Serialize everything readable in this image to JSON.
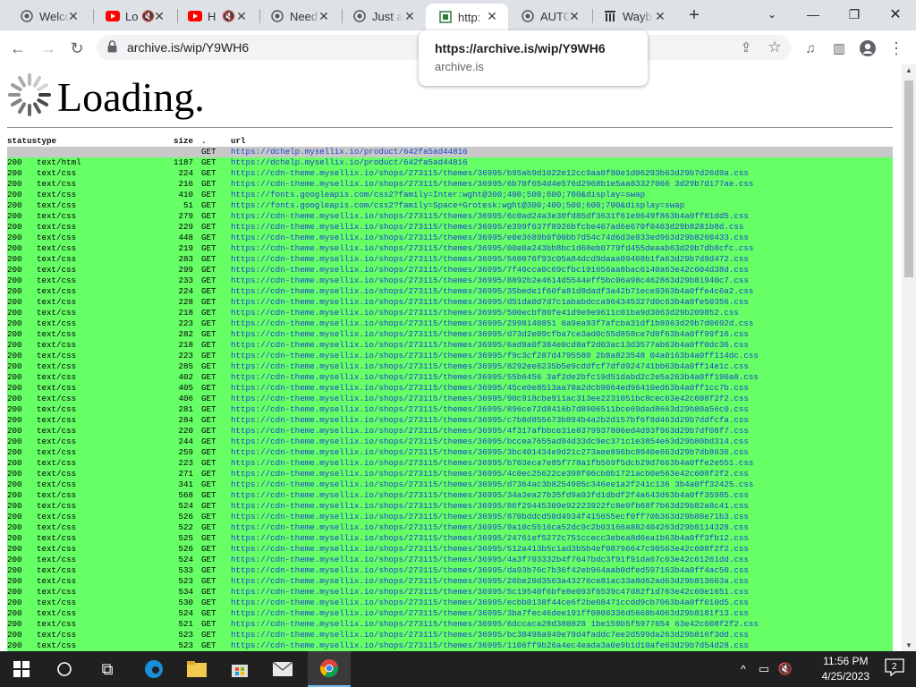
{
  "tabs": [
    {
      "title": "Welco",
      "icon": "globe-icon",
      "muted": false
    },
    {
      "title": "Lo",
      "icon": "youtube-icon",
      "muted": true
    },
    {
      "title": "H",
      "icon": "youtube-icon",
      "muted": true
    },
    {
      "title": "Need",
      "icon": "globe-icon",
      "muted": false
    },
    {
      "title": "Just a",
      "icon": "globe-icon",
      "muted": false
    },
    {
      "title": "http:",
      "icon": "archive-icon",
      "muted": false,
      "active": true
    },
    {
      "title": "AUTO",
      "icon": "globe-icon",
      "muted": false
    },
    {
      "title": "Wayb",
      "icon": "wayback-icon",
      "muted": false
    }
  ],
  "address_bar": {
    "url": "archive.is/wip/Y9WH6"
  },
  "tooltip": {
    "title": "https://archive.is/wip/Y9WH6",
    "host": "archive.is"
  },
  "page": {
    "loading_text": "Loading."
  },
  "table": {
    "headers": {
      "status": "status",
      "type": "type",
      "size": "size",
      "method": ".",
      "url": "url"
    },
    "rows": [
      {
        "status": "",
        "type": "",
        "size": "",
        "method": "GET",
        "url": "https://dchelp.mysellix.io/product/642fa5ad44816",
        "style": "gray"
      },
      {
        "status": "200",
        "type": "text/html",
        "size": "1187",
        "method": "GET",
        "url": "https://dchelp.mysellix.io/product/642fa5ad44816",
        "style": "green"
      },
      {
        "status": "200",
        "type": "text/css",
        "size": "224",
        "method": "GET",
        "url": "https://cdn-theme.mysellix.io/shops/273115/themes/36995/b95ab9d1022e12cc9aa0f80e1d06293b63d29b7d26d9a.css",
        "style": "green"
      },
      {
        "status": "200",
        "type": "text/css",
        "size": "216",
        "method": "GET",
        "url": "https://cdn-theme.mysellix.io/shops/273115/themes/36995/6b70f654d4e576d2968b1e5aa83327066 3d29b7d177ae.css",
        "style": "green"
      },
      {
        "status": "200",
        "type": "text/css",
        "size": "410",
        "method": "GET",
        "url": "https://fonts.googleapis.com/css2?family=Inter:wght@300;400;500;600;700&display=swap",
        "style": "green"
      },
      {
        "status": "200",
        "type": "text/css",
        "size": "51",
        "method": "GET",
        "url": "https://fonts.googleapis.com/css2?family=Space+Grotesk:wght@300;400;500;600;700&display=swap",
        "style": "green"
      },
      {
        "status": "200",
        "type": "text/css",
        "size": "279",
        "method": "GET",
        "url": "https://cdn-theme.mysellix.io/shops/273115/themes/36995/6c0ad24a3e30fd85df3631f61e9649f863b4a0ff81dd5.css",
        "style": "green"
      },
      {
        "status": "200",
        "type": "text/css",
        "size": "229",
        "method": "GET",
        "url": "https://cdn-theme.mysellix.io/shops/273115/themes/36995/e399f637f8926bfcbe467ad6e670f0463d29b8281b8d.css",
        "style": "green"
      },
      {
        "status": "200",
        "type": "text/css",
        "size": "448",
        "method": "GET",
        "url": "https://cdn-theme.mysellix.io/shops/273115/themes/36995/e0e3689b0f00bb7d54c74d6d3e833ed963d29b8260433.css",
        "style": "green"
      },
      {
        "status": "200",
        "type": "text/css",
        "size": "219",
        "method": "GET",
        "url": "https://cdn-theme.mysellix.io/shops/273115/themes/36995/00e0a243bb8bc1d68eb0779fd455deaab63d29b7db8cfc.css",
        "style": "green"
      },
      {
        "status": "200",
        "type": "text/css",
        "size": "283",
        "method": "GET",
        "url": "https://cdn-theme.mysellix.io/shops/273115/themes/36995/560076f93c05a84dcd9daaa09468b1fa63d29b7d9d472.css",
        "style": "green"
      },
      {
        "status": "200",
        "type": "text/css",
        "size": "299",
        "method": "GET",
        "url": "https://cdn-theme.mysellix.io/shops/273115/themes/36995/7f40cca0c69cfbc191656aa8bac6140a63e42c604d38d.css",
        "style": "green"
      },
      {
        "status": "200",
        "type": "text/css",
        "size": "233",
        "method": "GET",
        "url": "https://cdn-theme.mysellix.io/shops/273115/themes/36995/8892b2e4614d5544eff5bc06a98c462863d29b81940c7.css",
        "style": "green"
      },
      {
        "status": "200",
        "type": "text/css",
        "size": "224",
        "method": "GET",
        "url": "https://cdn-theme.mysellix.io/shops/273115/themes/36995/35bede1f60fa81d8dadf3a42b71ece9363b4a0ffe4c6a2.css",
        "style": "green"
      },
      {
        "status": "200",
        "type": "text/css",
        "size": "228",
        "method": "GET",
        "url": "https://cdn-theme.mysellix.io/shops/273115/themes/36995/d51da0d7d7c1ababdcca964345327d0c63b4a0fe50356.css",
        "style": "green"
      },
      {
        "status": "200",
        "type": "text/css",
        "size": "218",
        "method": "GET",
        "url": "https://cdn-theme.mysellix.io/shops/273115/themes/36995/500ecbf80fe41d9e9e9611c01ba9d3063d29b209852.css",
        "style": "green"
      },
      {
        "status": "200",
        "type": "text/css",
        "size": "223",
        "method": "GET",
        "url": "https://cdn-theme.mysellix.io/shops/273115/themes/36995/2998140851 6a9ea93f7afcba31df1b8963d29b7d0692d.css",
        "style": "green"
      },
      {
        "status": "200",
        "type": "text/css",
        "size": "282",
        "method": "GET",
        "url": "https://cdn-theme.mysellix.io/shops/273115/themes/36995/d73d2e09cfba7ce3ad0c55d858ce7d0f63b4a0ff99f16.css",
        "style": "green"
      },
      {
        "status": "200",
        "type": "text/css",
        "size": "218",
        "method": "GET",
        "url": "https://cdn-theme.mysellix.io/shops/273115/themes/36995/6ad9a0f384e0cd8af2d03ac13d3577ab63b4a0ff0dc36.css",
        "style": "green"
      },
      {
        "status": "200",
        "type": "text/css",
        "size": "223",
        "method": "GET",
        "url": "https://cdn-theme.mysellix.io/shops/273115/themes/36995/f9c3cf287d4795580 2b8a823548 04a0163b4a0ff114dc.css",
        "style": "green"
      },
      {
        "status": "200",
        "type": "text/css",
        "size": "285",
        "method": "GET",
        "url": "https://cdn-theme.mysellix.io/shops/273115/themes/36995/8292ee6235b5e9cddfcf7dfd924741bb63b4a0ff14e1c.css",
        "style": "green"
      },
      {
        "status": "200",
        "type": "text/css",
        "size": "402",
        "method": "GET",
        "url": "https://cdn-theme.mysellix.io/shops/273115/themes/36995/55b6456 3af2de2bfc19d51dabd2c2e5a263b4a0ff190a8.css",
        "style": "green"
      },
      {
        "status": "200",
        "type": "text/css",
        "size": "405",
        "method": "GET",
        "url": "https://cdn-theme.mysellix.io/shops/273115/themes/36995/45ce0e8513aa70a2dcb9064ed96410ed63b4a0ff1cc7b.css",
        "style": "green"
      },
      {
        "status": "200",
        "type": "text/css",
        "size": "406",
        "method": "GET",
        "url": "https://cdn-theme.mysellix.io/shops/273115/themes/36995/90c918cbe911ac313ee2231051bc8cec63e42c608f2f2.css",
        "style": "green"
      },
      {
        "status": "200",
        "type": "text/css",
        "size": "281",
        "method": "GET",
        "url": "https://cdn-theme.mysellix.io/shops/273115/themes/36995/896ce72d8416b7d8906511bce69dad8663d29b80a56c0.css",
        "style": "green"
      },
      {
        "status": "200",
        "type": "text/css",
        "size": "284",
        "method": "GET",
        "url": "https://cdn-theme.mysellix.io/shops/273115/themes/36995/c7b8d855673b894b4a2b2d157bf6f8d463d29b7ddfcfa.css",
        "style": "green"
      },
      {
        "status": "200",
        "type": "text/css",
        "size": "220",
        "method": "GET",
        "url": "https://cdn-theme.mysellix.io/shops/273115/themes/36995/4f317afbbce31e8379937806ed4d93f963d29b7df08f7.css",
        "style": "green"
      },
      {
        "status": "200",
        "type": "text/css",
        "size": "244",
        "method": "GET",
        "url": "https://cdn-theme.mysellix.io/shops/273115/themes/36995/bccea7655ad94d33dc9ec371c1e3854e63d29b80bd314.css",
        "style": "green"
      },
      {
        "status": "200",
        "type": "text/css",
        "size": "259",
        "method": "GET",
        "url": "https://cdn-theme.mysellix.io/shops/273115/themes/36995/3bc401434e9d21c273aee896bc8940e663d29b7db8636.css",
        "style": "green"
      },
      {
        "status": "200",
        "type": "text/css",
        "size": "223",
        "method": "GET",
        "url": "https://cdn-theme.mysellix.io/shops/273115/themes/36995/b703eca7e85f778a1fb569f5dcb29d7663b4a0ffe2e551.css",
        "style": "green"
      },
      {
        "status": "200",
        "type": "text/css",
        "size": "271",
        "method": "GET",
        "url": "https://cdn-theme.mysellix.io/shops/273115/themes/36995/4c0ec25622ce398f06cb0b1721acb0e563e42c608f2f2.css",
        "style": "green"
      },
      {
        "status": "200",
        "type": "text/css",
        "size": "341",
        "method": "GET",
        "url": "https://cdn-theme.mysellix.io/shops/273115/themes/36995/d7364ac3b8254905c346ee1a2f241c136 3b4a0ff32425.css",
        "style": "green"
      },
      {
        "status": "200",
        "type": "text/css",
        "size": "568",
        "method": "GET",
        "url": "https://cdn-theme.mysellix.io/shops/273115/themes/36995/34a3ea27b35fd9a93fd1dbdf2f4a643d63b4a0ff35985.css",
        "style": "green"
      },
      {
        "status": "200",
        "type": "text/css",
        "size": "524",
        "method": "GET",
        "url": "https://cdn-theme.mysellix.io/shops/273115/themes/36995/86f29445309e92223922fc8e0fb68f7b63d29b82a8c41.css",
        "style": "green"
      },
      {
        "status": "200",
        "type": "text/css",
        "size": "526",
        "method": "GET",
        "url": "https://cdn-theme.mysellix.io/shops/273115/themes/36995/870bddcd50d4934f415655ecf0ff70b363d29b80e71b3.css",
        "style": "green"
      },
      {
        "status": "200",
        "type": "text/css",
        "size": "522",
        "method": "GET",
        "url": "https://cdn-theme.mysellix.io/shops/273115/themes/36995/9a10c5516ca52dc9c2b03166a882404263d29b8114328.css",
        "style": "green"
      },
      {
        "status": "200",
        "type": "text/css",
        "size": "525",
        "method": "GET",
        "url": "https://cdn-theme.mysellix.io/shops/273115/themes/36995/24761ef5272c751ccecc3ebea8d6ea1b63b4a0ff3fb12.css",
        "style": "green"
      },
      {
        "status": "200",
        "type": "text/css",
        "size": "526",
        "method": "GET",
        "url": "https://cdn-theme.mysellix.io/shops/273115/themes/36995/512a413b5c1ad3b5b4ef08796647c90563e42c608f2f2.css",
        "style": "green"
      },
      {
        "status": "200",
        "type": "text/css",
        "size": "524",
        "method": "GET",
        "url": "https://cdn-theme.mysellix.io/shops/273115/themes/36995/4a3f703332b4f7647bdc3f91f91da67c63e42c61261dd.css",
        "style": "green"
      },
      {
        "status": "200",
        "type": "text/css",
        "size": "533",
        "method": "GET",
        "url": "https://cdn-theme.mysellix.io/shops/273115/themes/36995/da93b76c7b36f42eb964aab0dfed597163b4a0ff4ac50.css",
        "style": "green"
      },
      {
        "status": "200",
        "type": "text/css",
        "size": "523",
        "method": "GET",
        "url": "https://cdn-theme.mysellix.io/shops/273115/themes/36995/26be20d3563a43276ce81ac33a8d62ad63d29b813663a.css",
        "style": "green"
      },
      {
        "status": "200",
        "type": "text/css",
        "size": "534",
        "method": "GET",
        "url": "https://cdn-theme.mysellix.io/shops/273115/themes/36995/5c19540f6bfe8e093f6539c47d82f1d763e42c60e1651.css",
        "style": "green"
      },
      {
        "status": "200",
        "type": "text/css",
        "size": "530",
        "method": "GET",
        "url": "https://cdn-theme.mysellix.io/shops/273115/themes/36995/ecbb0138f44ce6f2be08471ccdd9cb7063b4a0ff610d5.css",
        "style": "green"
      },
      {
        "status": "200",
        "type": "text/css",
        "size": "524",
        "method": "GET",
        "url": "https://cdn-theme.mysellix.io/shops/273115/themes/36995/3ba7fec46dee191ff0800336d5668b4063d29b8181f13.css",
        "style": "green"
      },
      {
        "status": "200",
        "type": "text/css",
        "size": "521",
        "method": "GET",
        "url": "https://cdn-theme.mysellix.io/shops/273115/themes/36995/6dccaca28d380828 1be159b5f5977654 63e42c608f2f2.css",
        "style": "green"
      },
      {
        "status": "200",
        "type": "text/css",
        "size": "523",
        "method": "GET",
        "url": "https://cdn-theme.mysellix.io/shops/273115/themes/36995/bc30498a949e79d4faddc7ee2d599da263d29b816f3dd.css",
        "style": "green"
      },
      {
        "status": "200",
        "type": "text/css",
        "size": "523",
        "method": "GET",
        "url": "https://cdn-theme.mysellix.io/shops/273115/themes/36995/1106ff9b26a4ec4eada3a0e9b1d10afe63d29b7d54d28.css",
        "style": "green"
      }
    ]
  },
  "taskbar": {
    "time": "11:56 PM",
    "date": "4/25/2023",
    "notifications": "2"
  },
  "colors": {
    "row_green": "#66ff66",
    "row_gray": "#c8c8c8",
    "link": "#1a44cc"
  }
}
